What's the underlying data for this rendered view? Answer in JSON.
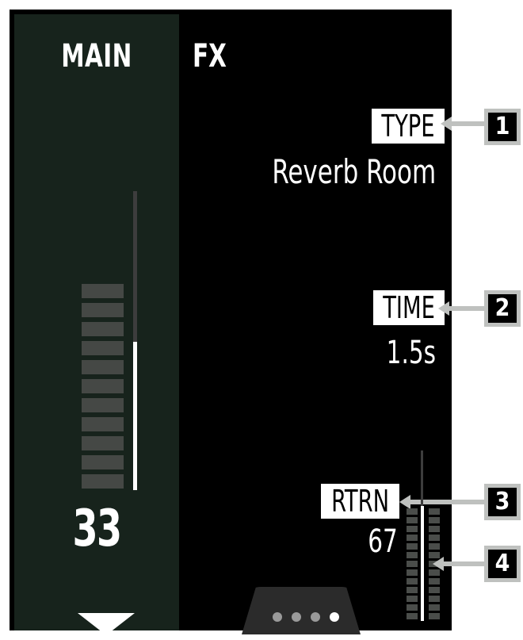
{
  "tabs": {
    "main": "MAIN",
    "fx": "FX"
  },
  "main_channel": {
    "value": "33",
    "fader_level_percent": 50,
    "meter_segments": 11
  },
  "params": [
    {
      "label": "TYPE",
      "value": "Reverb Room",
      "callout": "1"
    },
    {
      "label": "TIME",
      "value": "1.5s",
      "callout": "2"
    },
    {
      "label": "RTRN",
      "value": "67",
      "callout": "3"
    }
  ],
  "meter_callout": "4",
  "pagination": {
    "pages": 4,
    "active_index": 3
  },
  "colors": {
    "panel": "#17231c",
    "background": "#000000",
    "callout": "#bfc1bf",
    "meter_off": "#454845"
  }
}
